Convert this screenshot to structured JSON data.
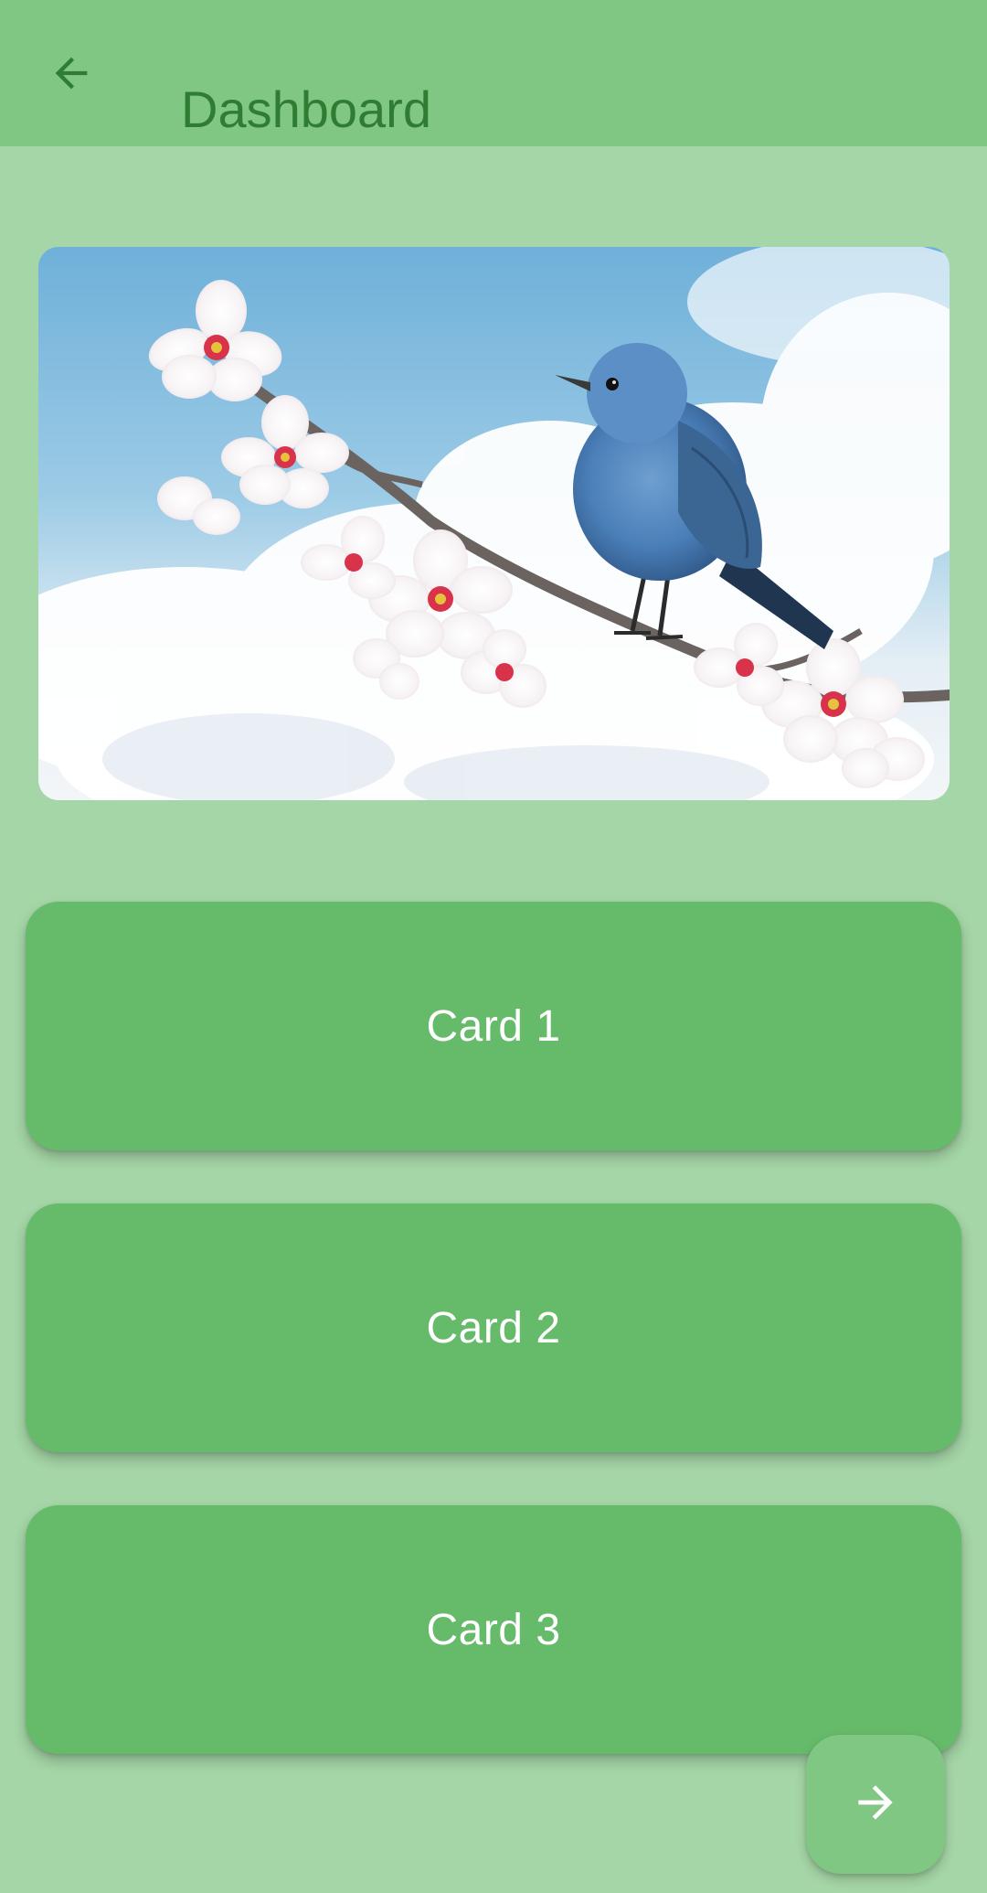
{
  "app_bar": {
    "title": "Dashboard",
    "back_icon": "arrow-back-icon",
    "background": "#81c784",
    "title_color": "#2e7d32"
  },
  "hero_image": {
    "subject": "blue bird perched on a cherry blossom branch against a cloudy sky"
  },
  "cards": [
    {
      "label": "Card 1"
    },
    {
      "label": "Card 2"
    },
    {
      "label": "Card 3"
    }
  ],
  "fab": {
    "icon": "arrow-forward-icon",
    "color": "#81c784"
  },
  "colors": {
    "page_background": "#a5d6a7",
    "card": "#66bb6a",
    "card_text": "#ffffff"
  }
}
